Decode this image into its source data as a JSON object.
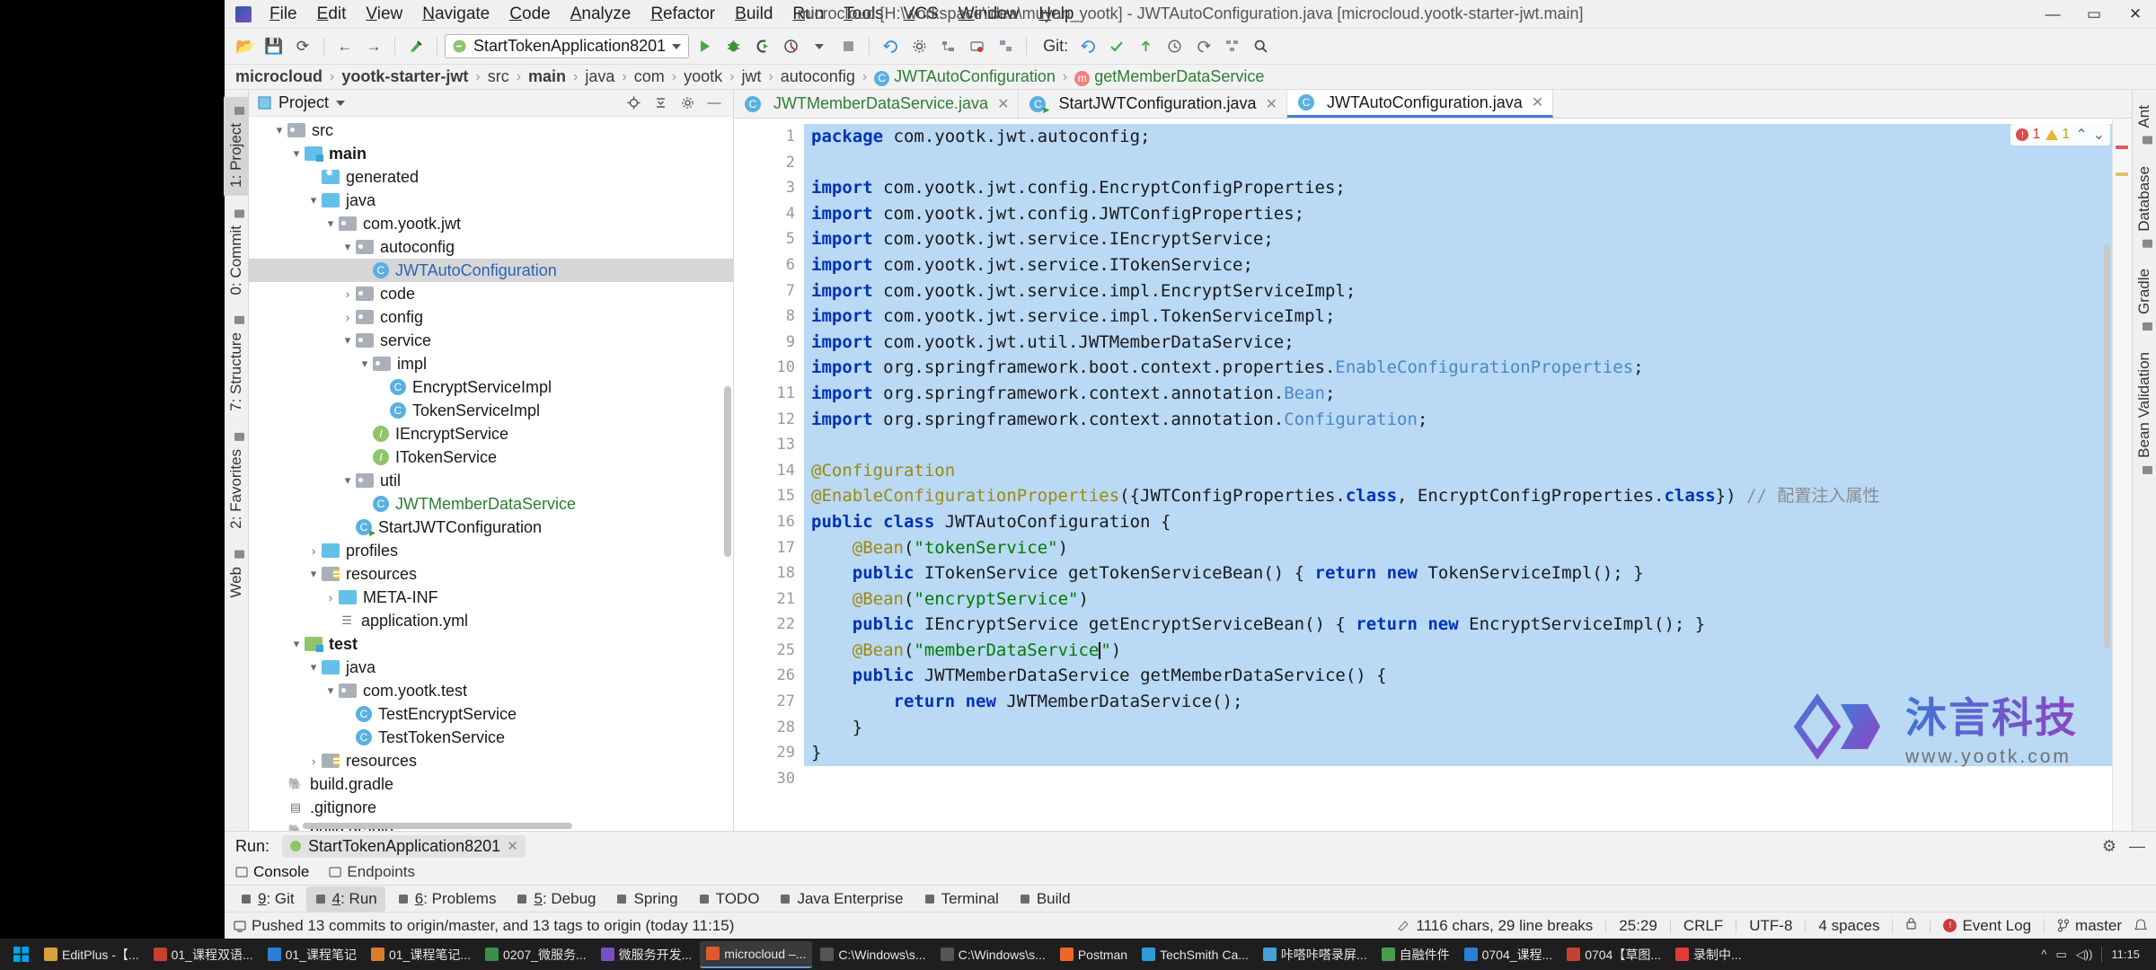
{
  "window": {
    "title": "microcloud [H:\\workspace\\idea\\muyan_yootk] - JWTAutoConfiguration.java [microcloud.yootk-starter-jwt.main]",
    "minimize": "—",
    "maximize": "▭",
    "close": "✕"
  },
  "menu": [
    "File",
    "Edit",
    "View",
    "Navigate",
    "Code",
    "Analyze",
    "Refactor",
    "Build",
    "Run",
    "Tools",
    "VCS",
    "Window",
    "Help"
  ],
  "toolbar": {
    "open": "📂",
    "save": "💾",
    "sync": "⟳",
    "back": "←",
    "forward": "→",
    "build": "🔨",
    "run_config": "StartTokenApplication8201",
    "run": "▶",
    "debug": "🐞",
    "run_coverage": "▶",
    "profile": "⏱",
    "stop": "■",
    "git_label": "Git:",
    "git_update": "✓",
    "git_commit": "✔",
    "git_push": "↑",
    "search": "🔍"
  },
  "breadcrumb": [
    {
      "label": "microcloud",
      "style": "bold"
    },
    {
      "label": "yootk-starter-jwt",
      "style": "bold"
    },
    {
      "label": "src",
      "style": "plain"
    },
    {
      "label": "main",
      "style": "bold"
    },
    {
      "label": "java",
      "style": "plain"
    },
    {
      "label": "com",
      "style": "plain"
    },
    {
      "label": "yootk",
      "style": "plain"
    },
    {
      "label": "jwt",
      "style": "plain"
    },
    {
      "label": "autoconfig",
      "style": "plain"
    },
    {
      "label": "JWTAutoConfiguration",
      "style": "class"
    },
    {
      "label": "getMemberDataService",
      "style": "method"
    }
  ],
  "left_strip": [
    {
      "label": "1: Project",
      "active": true,
      "icon": "project-icon"
    },
    {
      "label": "0: Commit",
      "active": false,
      "icon": "commit-icon"
    },
    {
      "label": "7: Structure",
      "active": false,
      "icon": "structure-icon"
    },
    {
      "label": "2: Favorites",
      "active": false,
      "icon": "favorites-icon"
    },
    {
      "label": "Web",
      "active": false,
      "icon": "web-icon"
    }
  ],
  "right_strip": [
    {
      "label": "Ant",
      "icon": "ant-icon"
    },
    {
      "label": "Database",
      "icon": "database-icon"
    },
    {
      "label": "Gradle",
      "icon": "gradle-icon"
    },
    {
      "label": "Bean Validation",
      "icon": "bean-icon"
    }
  ],
  "project_panel": {
    "title": "Project",
    "dropdown": "▾",
    "icons": [
      "locate-icon",
      "collapse-all-icon",
      "settings-icon",
      "hide-icon"
    ],
    "tree": [
      {
        "label": "src",
        "depth": 1,
        "arrow": "▾",
        "icon": "folder-grey",
        "style": "",
        "sel": false
      },
      {
        "label": "main",
        "depth": 2,
        "arrow": "▾",
        "icon": "folder-source",
        "style": "bold",
        "sel": false
      },
      {
        "label": "generated",
        "depth": 3,
        "arrow": "",
        "icon": "folder-generated",
        "style": "",
        "sel": false
      },
      {
        "label": "java",
        "depth": 3,
        "arrow": "▾",
        "icon": "folder-blue",
        "style": "",
        "sel": false
      },
      {
        "label": "com.yootk.jwt",
        "depth": 4,
        "arrow": "▾",
        "icon": "folder-pkg",
        "style": "",
        "sel": false
      },
      {
        "label": "autoconfig",
        "depth": 5,
        "arrow": "▾",
        "icon": "folder-pkg",
        "style": "",
        "sel": false
      },
      {
        "label": "JWTAutoConfiguration",
        "depth": 6,
        "arrow": "",
        "icon": "class-badge",
        "style": "blue",
        "sel": true
      },
      {
        "label": "code",
        "depth": 5,
        "arrow": "›",
        "icon": "folder-pkg",
        "style": "",
        "sel": false
      },
      {
        "label": "config",
        "depth": 5,
        "arrow": "›",
        "icon": "folder-pkg",
        "style": "",
        "sel": false
      },
      {
        "label": "service",
        "depth": 5,
        "arrow": "▾",
        "icon": "folder-pkg",
        "style": "",
        "sel": false
      },
      {
        "label": "impl",
        "depth": 6,
        "arrow": "▾",
        "icon": "folder-pkg",
        "style": "",
        "sel": false
      },
      {
        "label": "EncryptServiceImpl",
        "depth": 7,
        "arrow": "",
        "icon": "class-badge",
        "style": "",
        "sel": false
      },
      {
        "label": "TokenServiceImpl",
        "depth": 7,
        "arrow": "",
        "icon": "class-badge",
        "style": "",
        "sel": false
      },
      {
        "label": "IEncryptService",
        "depth": 6,
        "arrow": "",
        "icon": "interface-badge",
        "style": "",
        "sel": false
      },
      {
        "label": "ITokenService",
        "depth": 6,
        "arrow": "",
        "icon": "interface-badge",
        "style": "",
        "sel": false
      },
      {
        "label": "util",
        "depth": 5,
        "arrow": "▾",
        "icon": "folder-pkg",
        "style": "",
        "sel": false
      },
      {
        "label": "JWTMemberDataService",
        "depth": 6,
        "arrow": "",
        "icon": "class-badge",
        "style": "green",
        "sel": false
      },
      {
        "label": "StartJWTConfiguration",
        "depth": 5,
        "arrow": "",
        "icon": "class-run-badge",
        "style": "",
        "sel": false
      },
      {
        "label": "profiles",
        "depth": 3,
        "arrow": "›",
        "icon": "folder-blue",
        "style": "",
        "sel": false
      },
      {
        "label": "resources",
        "depth": 3,
        "arrow": "▾",
        "icon": "folder-resources",
        "style": "",
        "sel": false
      },
      {
        "label": "META-INF",
        "depth": 4,
        "arrow": "›",
        "icon": "folder-blue",
        "style": "",
        "sel": false
      },
      {
        "label": "application.yml",
        "depth": 4,
        "arrow": "",
        "icon": "yml-badge",
        "style": "",
        "sel": false
      },
      {
        "label": "test",
        "depth": 2,
        "arrow": "▾",
        "icon": "folder-test",
        "style": "bold",
        "sel": false
      },
      {
        "label": "java",
        "depth": 3,
        "arrow": "▾",
        "icon": "folder-blue",
        "style": "",
        "sel": false
      },
      {
        "label": "com.yootk.test",
        "depth": 4,
        "arrow": "▾",
        "icon": "folder-pkg",
        "style": "",
        "sel": false
      },
      {
        "label": "TestEncryptService",
        "depth": 5,
        "arrow": "",
        "icon": "class-badge",
        "style": "",
        "sel": false
      },
      {
        "label": "TestTokenService",
        "depth": 5,
        "arrow": "",
        "icon": "class-badge",
        "style": "",
        "sel": false
      },
      {
        "label": "resources",
        "depth": 3,
        "arrow": "›",
        "icon": "folder-resources",
        "style": "",
        "sel": false
      },
      {
        "label": "build.gradle",
        "depth": 1,
        "arrow": "",
        "icon": "gradle-badge",
        "style": "",
        "sel": false
      },
      {
        "label": ".gitignore",
        "depth": 1,
        "arrow": "",
        "icon": "file-badge",
        "style": "",
        "sel": false
      },
      {
        "label": "build.gradle",
        "depth": 1,
        "arrow": "",
        "icon": "gradle-badge",
        "style": "",
        "sel": false
      }
    ]
  },
  "editor_tabs": [
    {
      "label": "JWTMemberDataService.java",
      "icon": "class-badge",
      "color": "green",
      "active": false,
      "close": "✕"
    },
    {
      "label": "StartJWTConfiguration.java",
      "icon": "class-run-badge",
      "color": "dark",
      "active": false,
      "close": "✕"
    },
    {
      "label": "JWTAutoConfiguration.java",
      "icon": "class-badge",
      "color": "dark",
      "active": true,
      "close": "✕"
    }
  ],
  "inspection": {
    "errors": "1",
    "warnings": "1",
    "up": "⌃",
    "down": "⌄"
  },
  "code": {
    "gutter": [
      "1",
      "2",
      "3",
      "4",
      "5",
      "6",
      "7",
      "8",
      "9",
      "10",
      "11",
      "12",
      "13",
      "14",
      "15",
      "16",
      "17",
      "18",
      "21",
      "22",
      "25",
      "26",
      "27",
      "28",
      "29",
      "30"
    ],
    "lines": [
      {
        "n": "1",
        "text": "package com.yootk.jwt.autoconfig;",
        "type": "pkg",
        "hl": true
      },
      {
        "n": "2",
        "text": "",
        "type": "blank",
        "hl": true
      },
      {
        "n": "3",
        "text": "import com.yootk.jwt.config.EncryptConfigProperties;",
        "type": "imp",
        "hl": true
      },
      {
        "n": "4",
        "text": "import com.yootk.jwt.config.JWTConfigProperties;",
        "type": "imp",
        "hl": true
      },
      {
        "n": "5",
        "text": "import com.yootk.jwt.service.IEncryptService;",
        "type": "imp",
        "hl": true
      },
      {
        "n": "6",
        "text": "import com.yootk.jwt.service.ITokenService;",
        "type": "imp",
        "hl": true
      },
      {
        "n": "7",
        "text": "import com.yootk.jwt.service.impl.EncryptServiceImpl;",
        "type": "imp",
        "hl": true
      },
      {
        "n": "8",
        "text": "import com.yootk.jwt.service.impl.TokenServiceImpl;",
        "type": "imp",
        "hl": true
      },
      {
        "n": "9",
        "text": "import com.yootk.jwt.util.JWTMemberDataService;",
        "type": "imp",
        "hl": true
      },
      {
        "n": "10",
        "text": "import org.springframework.boot.context.properties.EnableConfigurationProperties;",
        "type": "imp-lb",
        "hl": true
      },
      {
        "n": "11",
        "text": "import org.springframework.context.annotation.Bean;",
        "type": "imp-lb",
        "hl": true
      },
      {
        "n": "12",
        "text": "import org.springframework.context.annotation.Configuration;",
        "type": "imp-lb",
        "hl": true
      },
      {
        "n": "13",
        "text": "",
        "type": "blank",
        "hl": true
      },
      {
        "n": "14",
        "text": "@Configuration",
        "type": "ann",
        "hl": true
      },
      {
        "n": "15",
        "text": "@EnableConfigurationProperties({JWTConfigProperties.class, EncryptConfigProperties.class}) // 配置注入属性",
        "type": "ann-cmt",
        "hl": true
      },
      {
        "n": "16",
        "text": "public class JWTAutoConfiguration {",
        "type": "cls",
        "hl": true
      },
      {
        "n": "17",
        "text": "    @Bean(\"tokenService\")",
        "type": "bean",
        "hl": true
      },
      {
        "n": "18",
        "text": "    public ITokenService getTokenServiceBean() { return new TokenServiceImpl(); }",
        "type": "meth",
        "hl": true
      },
      {
        "n": "21",
        "text": "    @Bean(\"encryptService\")",
        "type": "bean",
        "hl": true
      },
      {
        "n": "22",
        "text": "    public IEncryptService getEncryptServiceBean() { return new EncryptServiceImpl(); }",
        "type": "meth",
        "hl": true
      },
      {
        "n": "25",
        "text": "    @Bean(\"memberDataService\")",
        "type": "bean-caret",
        "hl": true
      },
      {
        "n": "26",
        "text": "    public JWTMemberDataService getMemberDataService() {",
        "type": "meth2",
        "hl": true
      },
      {
        "n": "27",
        "text": "        return new JWTMemberDataService();",
        "type": "ret",
        "hl": true
      },
      {
        "n": "28",
        "text": "    }",
        "type": "plain",
        "hl": true
      },
      {
        "n": "29",
        "text": "}",
        "type": "plain",
        "hl": true
      },
      {
        "n": "30",
        "text": "",
        "type": "blank",
        "hl": false
      }
    ]
  },
  "watermark": {
    "brand": "沐言科技",
    "site": "www.yootk.com"
  },
  "run_panel": {
    "label": "Run:",
    "config": "StartTokenApplication8201",
    "close": "✕",
    "settings": "⚙",
    "hide": "—",
    "tabs": [
      {
        "label": "Console",
        "icon": "console-icon",
        "active": true
      },
      {
        "label": "Endpoints",
        "icon": "endpoints-icon",
        "active": false
      }
    ]
  },
  "bottom_tools": [
    {
      "label": "9: Git",
      "icon": "git-icon",
      "active": false
    },
    {
      "label": "4: Run",
      "icon": "run-icon",
      "active": true
    },
    {
      "label": "6: Problems",
      "icon": "problems-icon",
      "active": false
    },
    {
      "label": "5: Debug",
      "icon": "debug-icon",
      "active": false
    },
    {
      "label": "Spring",
      "icon": "spring-icon",
      "active": false
    },
    {
      "label": "TODO",
      "icon": "todo-icon",
      "active": false
    },
    {
      "label": "Java Enterprise",
      "icon": "java-ee-icon",
      "active": false
    },
    {
      "label": "Terminal",
      "icon": "terminal-icon",
      "active": false
    },
    {
      "label": "Build",
      "icon": "build-icon",
      "active": false
    }
  ],
  "status_bar": {
    "message": "Pushed 13 commits to origin/master, and 13 tags to origin (today 11:15)",
    "message_icon": "message-icon",
    "chars": "1116 chars, 29 line breaks",
    "chars_icon": "edit-icon",
    "position": "25:29",
    "line_sep": "CRLF",
    "encoding": "UTF-8",
    "indent": "4 spaces",
    "event_log": "Event Log",
    "event_icon": "event-icon",
    "branch": "master",
    "branch_icon": "branch-icon",
    "lock_icon": "lock-icon"
  },
  "taskbar": {
    "start": "⊞",
    "items": [
      {
        "label": "EditPlus -【...",
        "color": "#d9a13b"
      },
      {
        "label": "01_课程双语...",
        "color": "#c6412f"
      },
      {
        "label": "01_课程笔记",
        "color": "#2b7fd4"
      },
      {
        "label": "01_课程笔记...",
        "color": "#d97f2b"
      },
      {
        "label": "0207_微服务...",
        "color": "#3a8f4a"
      },
      {
        "label": "微服务开发...",
        "color": "#7b4fc4"
      },
      {
        "label": "microcloud –...",
        "color": "#e05b2b",
        "active": true
      },
      {
        "label": "C:\\Windows\\s...",
        "color": "#555555"
      },
      {
        "label": "C:\\Windows\\s...",
        "color": "#555555"
      },
      {
        "label": "Postman",
        "color": "#f06529"
      },
      {
        "label": "TechSmith Ca...",
        "color": "#2d9cdb"
      },
      {
        "label": "咔嗒咔嗒录屏...",
        "color": "#44a2d6"
      },
      {
        "label": "自融件件",
        "color": "#4a9e4a"
      },
      {
        "label": "0704_课程...",
        "color": "#2b7fd4"
      },
      {
        "label": "0704【草图...",
        "color": "#c6412f"
      },
      {
        "label": "录制中...",
        "color": "#e03b3b"
      }
    ],
    "tray": [
      "^",
      "🌐",
      "🔊",
      "🔋"
    ]
  }
}
